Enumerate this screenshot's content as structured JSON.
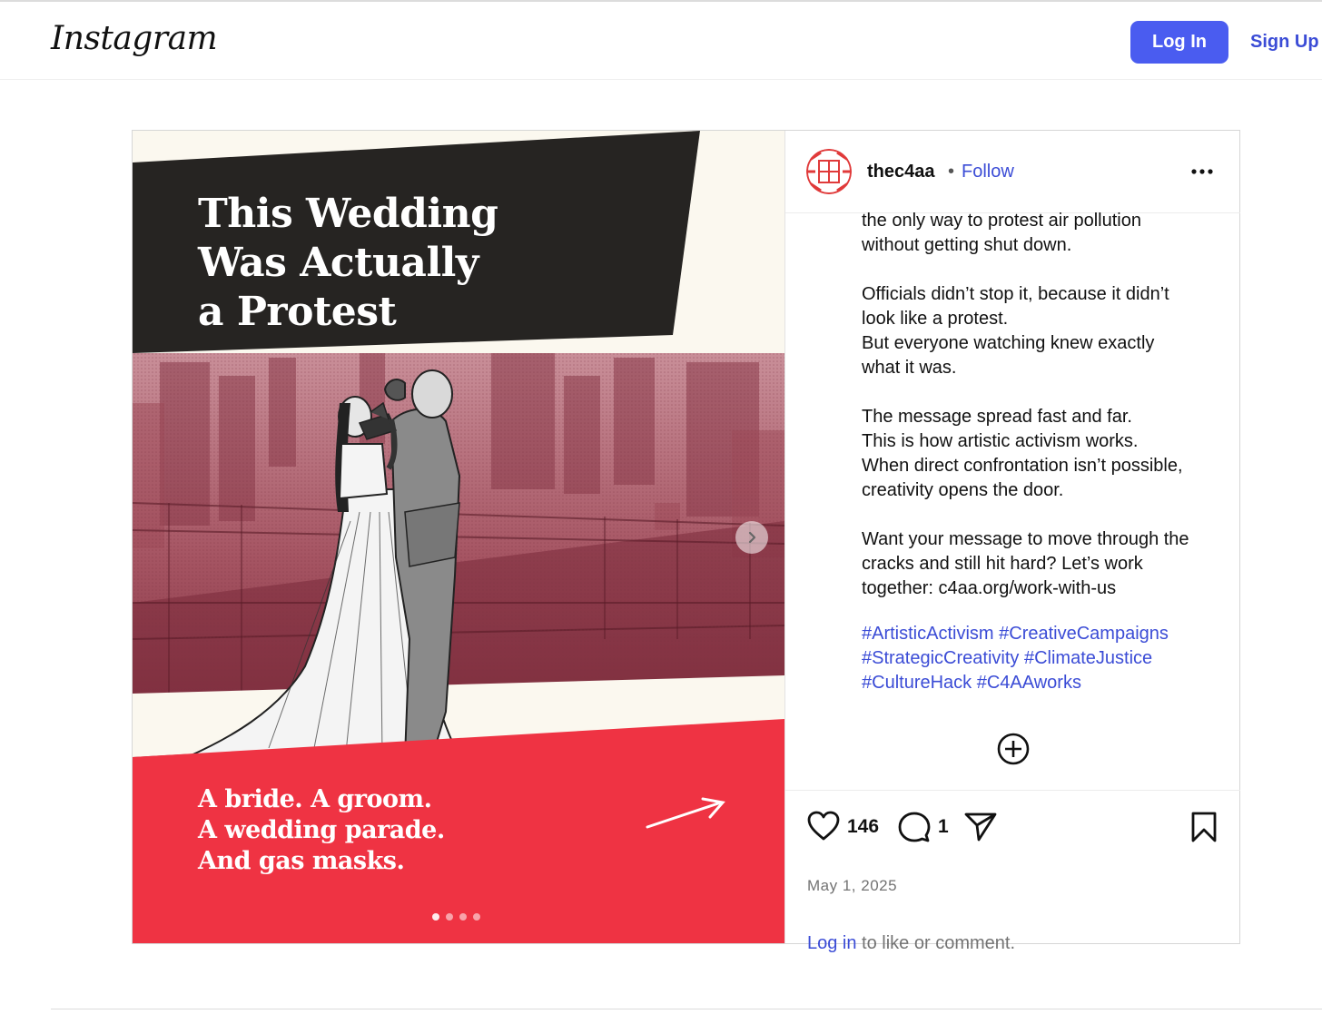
{
  "header": {
    "logo_text": "Instagram",
    "login_label": "Log In",
    "signup_label": "Sign Up",
    "accent_color": "#4a5cf0"
  },
  "post": {
    "image": {
      "headline": [
        "This Wedding",
        "Was Actually",
        "a Protest"
      ],
      "subline": [
        "A bride. A groom.",
        "A wedding parade.",
        "And gas masks."
      ],
      "carousel_dots": 4,
      "active_dot": 1,
      "next_icon": "chevron-right-icon"
    },
    "author": {
      "username": "thec4aa",
      "separator": "•",
      "follow_label": "Follow",
      "more_icon": "more-horizontal-icon"
    },
    "caption": {
      "paragraphs": [
        [
          "the only way to protest air pollution",
          "without getting shut down."
        ],
        [
          "Officials didn’t stop it, because it didn’t",
          "look like a protest.",
          "But everyone watching knew exactly",
          "what it was."
        ],
        [
          "The message spread fast and far.",
          "This is how artistic activism works.",
          "When direct confrontation isn’t possible,",
          "creativity opens the door."
        ],
        [
          "Want your message to move through the",
          "cracks and still hit hard? Let’s work",
          "together: c4aa.org/work-with-us"
        ]
      ],
      "hashtags": [
        [
          "#ArtisticActivism",
          "#CreativeCampaigns"
        ],
        [
          "#StrategicCreativity",
          "#ClimateJustice"
        ],
        [
          "#CultureHack",
          "#C4AAworks"
        ]
      ]
    },
    "actions": {
      "like_icon": "heart-icon",
      "likes": "146",
      "comment_icon": "comment-icon",
      "comments": "1",
      "share_icon": "send-icon",
      "save_icon": "bookmark-icon",
      "load_more_icon": "plus-circle-icon"
    },
    "date": "May 1, 2025",
    "login_prompt": {
      "link": "Log in",
      "text": " to like or comment."
    }
  }
}
